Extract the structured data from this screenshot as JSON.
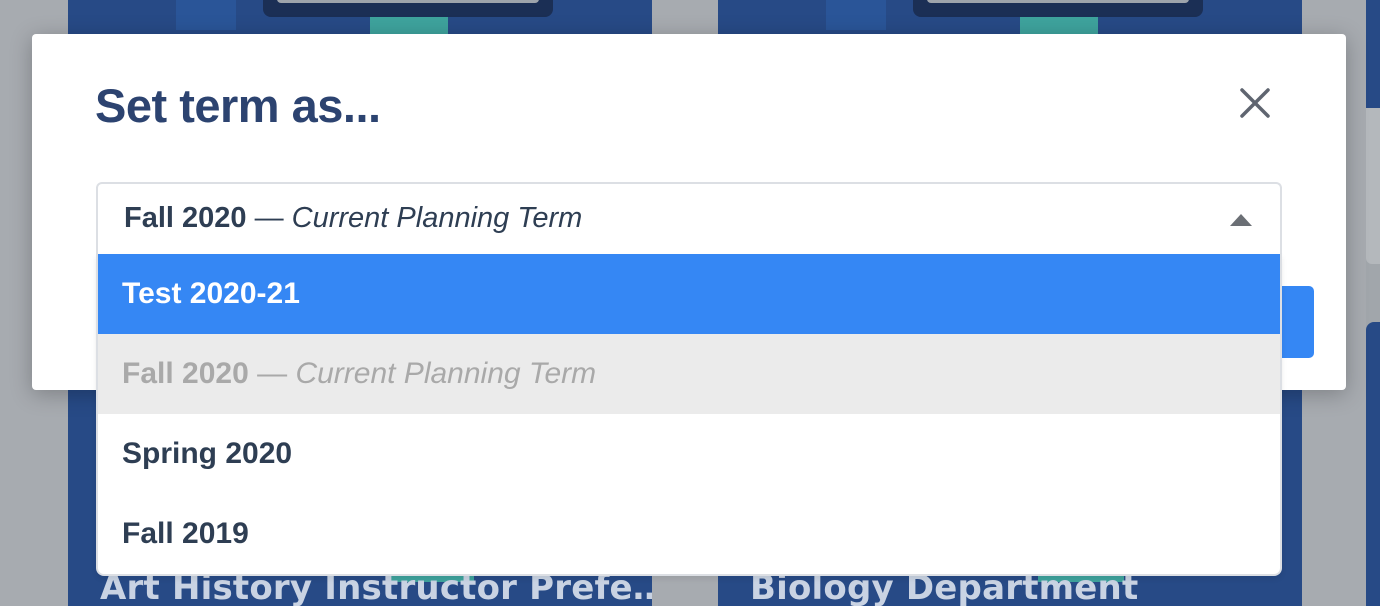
{
  "background": {
    "cards": [
      {
        "title": "Art History Instructor Prefe…"
      },
      {
        "title": "Biology Department"
      }
    ]
  },
  "modal": {
    "title": "Set term as...",
    "close_icon": "close-icon",
    "select": {
      "selected_name": "Fall 2020",
      "selected_separator": " — ",
      "selected_note": "Current Planning Term",
      "arrow_icon": "caret-up-icon",
      "options": [
        {
          "name": "Test 2020-21",
          "separator": "",
          "note": "",
          "state": "highlighted"
        },
        {
          "name": "Fall 2020",
          "separator": " — ",
          "note": "Current Planning Term",
          "state": "selected-disabled"
        },
        {
          "name": "Spring 2020",
          "separator": "",
          "note": "",
          "state": "normal"
        },
        {
          "name": "Fall 2019",
          "separator": "",
          "note": "",
          "state": "normal"
        }
      ]
    }
  },
  "colors": {
    "accent": "#3587f4",
    "title": "#2c4370",
    "text": "#2e3e53",
    "disabled_text": "#a9a9a9",
    "disabled_bg": "#ebebeb",
    "card_bg": "#274a86",
    "teal": "#3ea39d"
  }
}
